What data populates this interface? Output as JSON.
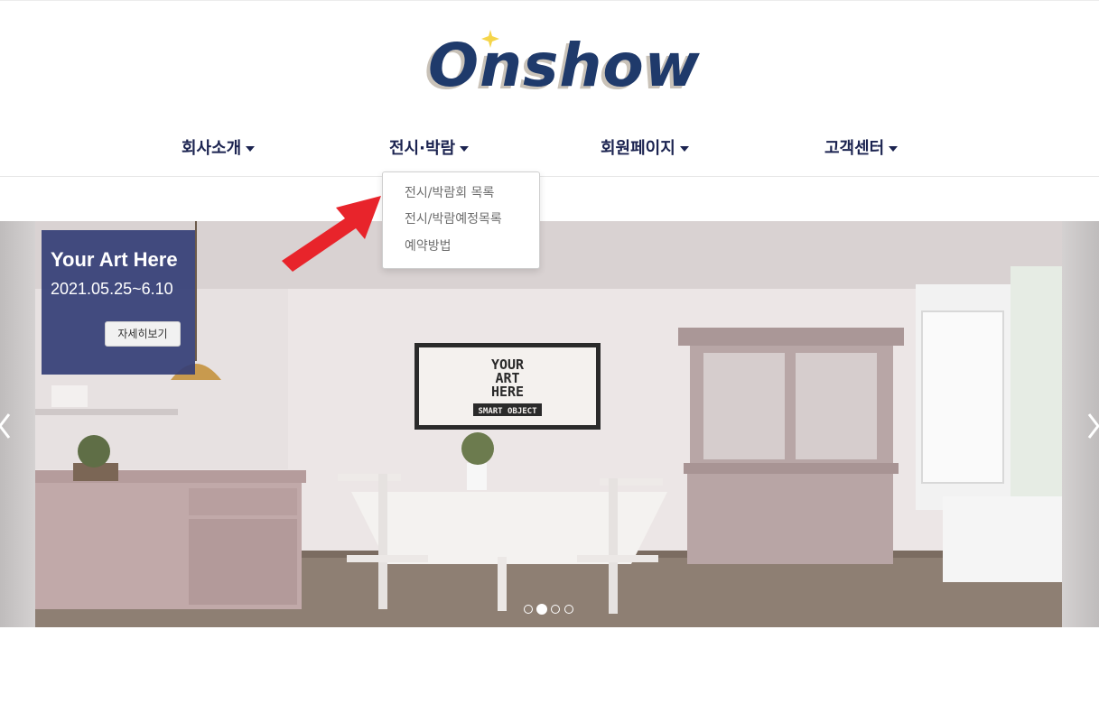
{
  "logo": {
    "text": "Onshow"
  },
  "nav": {
    "items": [
      {
        "label": "회사소개"
      },
      {
        "label": "전시·박람"
      },
      {
        "label": "회원페이지"
      },
      {
        "label": "고객센터"
      }
    ]
  },
  "dropdown": {
    "items": [
      {
        "label": "전시/박람회 목록"
      },
      {
        "label": "전시/박람예정목록"
      },
      {
        "label": "예약방법"
      }
    ]
  },
  "carousel": {
    "caption": {
      "title": "Your Art Here",
      "date": "2021.05.25~6.10",
      "button_label": "자세히보기"
    },
    "indicators_count": 4,
    "active_index": 1,
    "frame": {
      "line1": "YOUR",
      "line2": "ART",
      "line3": "HERE",
      "line4": "SMART OBJECT"
    }
  },
  "colors": {
    "nav_text": "#1b2350",
    "logo": "#1f3a6b",
    "caption_bg": "#343e76",
    "annotation_arrow": "#e8242b"
  }
}
